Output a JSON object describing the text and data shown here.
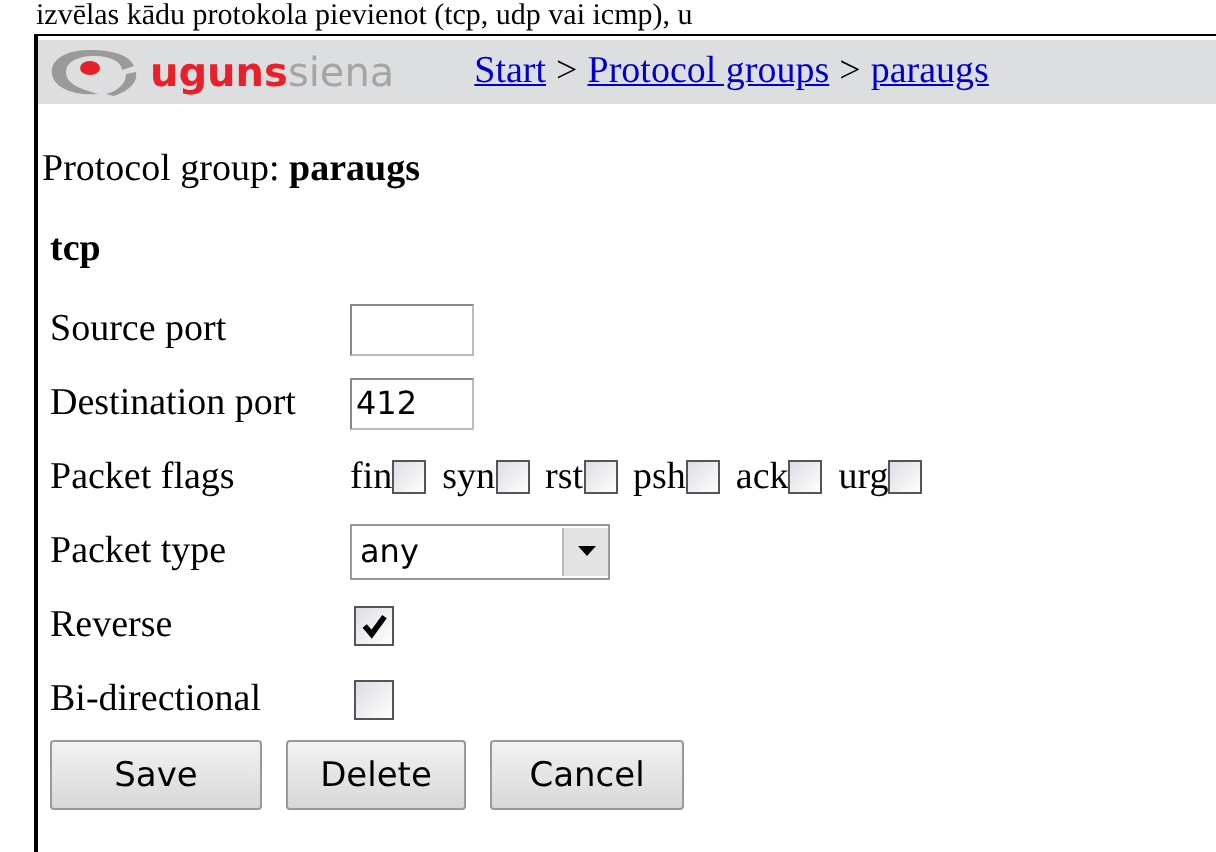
{
  "document_text": "izvēlas kādu protokola pievienot (tcp, udp vai icmp), u",
  "header": {
    "logo": {
      "part_1": "uguns",
      "part_2": "siena"
    },
    "breadcrumb": [
      {
        "label": "Start"
      },
      {
        "label": "Protocol groups"
      },
      {
        "label": "paraugs"
      }
    ],
    "separator": ">"
  },
  "group_line": "Protocol group: **paraugs**",
  "section_title": "tcp",
  "rows": [
    {
      "kind": "text",
      "label": "Source port",
      "value": ""
    },
    {
      "kind": "text",
      "label": "Destination port",
      "value": "412"
    },
    {
      "kind": "flags",
      "label": "Packet flags",
      "flags": [
        {
          "label": "fin",
          "checked": false
        },
        {
          "label": "syn",
          "checked": false
        },
        {
          "label": "rst",
          "checked": false
        },
        {
          "label": "psh",
          "checked": false
        },
        {
          "label": "ack",
          "checked": false
        },
        {
          "label": "urg",
          "checked": false
        }
      ]
    },
    {
      "kind": "select",
      "label": "Packet type",
      "value": "any"
    },
    {
      "kind": "checkbox",
      "label": "Reverse",
      "checked": true
    },
    {
      "kind": "checkbox",
      "label": "Bi-directional",
      "checked": false
    }
  ],
  "buttons": [
    "Save",
    "Delete",
    "Cancel"
  ]
}
